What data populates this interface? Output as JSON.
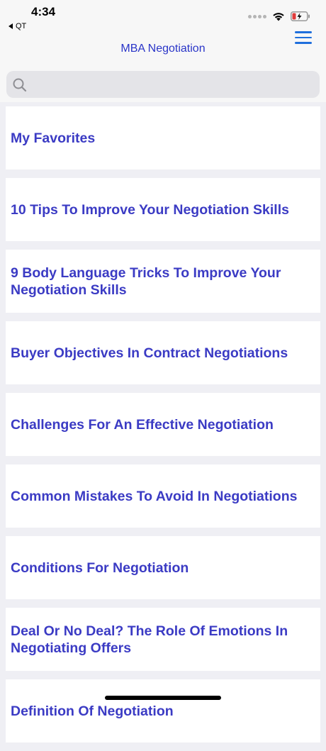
{
  "status_bar": {
    "time": "4:34",
    "back_app": "QT"
  },
  "nav": {
    "title": "MBA Negotiation",
    "menu_icon": "hamburger-menu-icon"
  },
  "search": {
    "placeholder": "",
    "icon": "search-icon"
  },
  "colors": {
    "accent": "#3b3bc4",
    "nav_title": "#2a35c8",
    "menu_blue": "#1f6fdc"
  },
  "topics": [
    "My Favorites",
    "10 Tips To Improve Your Negotiation Skills",
    "9 Body Language Tricks To Improve Your Negotiation Skills",
    "Buyer Objectives In Contract Negotiations",
    "Challenges For An Effective Negotiation",
    "Common Mistakes To Avoid In Negotiations",
    "Conditions For Negotiation",
    "Deal Or No Deal? The Role Of Emotions In Negotiating Offers",
    "Definition Of Negotiation"
  ]
}
